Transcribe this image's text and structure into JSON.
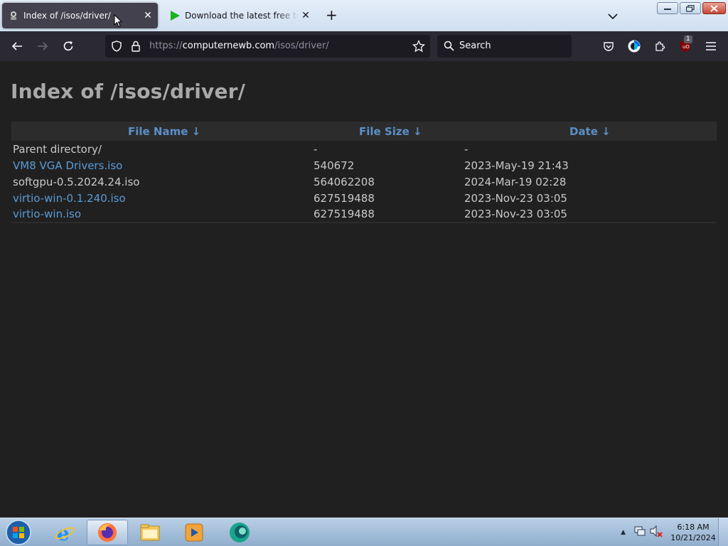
{
  "browser": {
    "tabs": [
      {
        "title": "Index of /isos/driver/",
        "active": true
      },
      {
        "title": "Download the latest free trial version",
        "active": false
      }
    ],
    "url_scheme": "https://",
    "url_host": "computernewb.com",
    "url_path": "/isos/driver/",
    "search_placeholder": "Search",
    "extension_badge": "1"
  },
  "page": {
    "title": "Index of /isos/driver/",
    "columns": [
      "File Name  ↓",
      "File Size  ↓",
      "Date  ↓"
    ],
    "rows": [
      {
        "name": "Parent directory/",
        "size": "-",
        "date": "-",
        "link": false
      },
      {
        "name": "VM8 VGA Drivers.iso",
        "size": "540672",
        "date": "2023-May-19 21:43",
        "link": true
      },
      {
        "name": "softgpu-0.5.2024.24.iso",
        "size": "564062208",
        "date": "2024-Mar-19 02:28",
        "link": false
      },
      {
        "name": "virtio-win-0.1.240.iso",
        "size": "627519488",
        "date": "2023-Nov-23 03:05",
        "link": true
      },
      {
        "name": "virtio-win.iso",
        "size": "627519488",
        "date": "2023-Nov-23 03:05",
        "link": true
      }
    ]
  },
  "taskbar": {
    "time": "6:18 AM",
    "date": "10/21/2024"
  },
  "colors": {
    "page_bg": "#202020",
    "header_link": "#5b8fc7",
    "file_link": "#5b9bd5",
    "toolbar": "#2b2a33"
  }
}
